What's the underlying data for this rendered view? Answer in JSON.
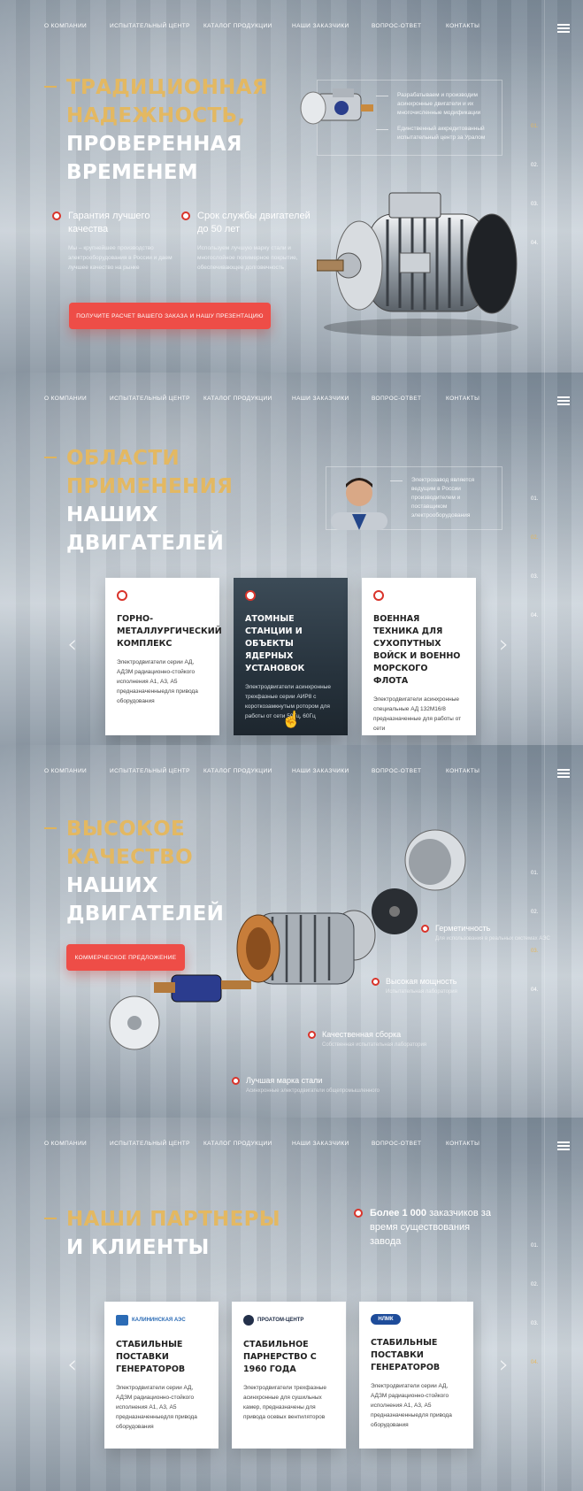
{
  "nav": {
    "items": [
      "О КОМПАНИИ",
      "ИСПЫТАТЕЛЬНЫЙ ЦЕНТР",
      "КАТАЛОГ ПРОДУКЦИИ",
      "НАШИ ЗАКАЗЧИКИ",
      "ВОПРОС-ОТВЕТ",
      "КОНТАКТЫ"
    ]
  },
  "pager": [
    "01.",
    "02.",
    "03.",
    "04."
  ],
  "hero": {
    "title_gold": [
      "ТРАДИЦИОННАЯ",
      "НАДЕЖНОСТЬ,"
    ],
    "title_white": [
      "ПРОВЕРЕННАЯ",
      "ВРЕМЕНЕМ"
    ],
    "info": [
      "Разрабатываем и производим асинхронные двигатели и их многочисленные модификации",
      "Единственный аккредитованный испытательный центр за Уралом"
    ],
    "features": [
      {
        "title": "Гарантия лучшего качества",
        "text": "Мы – крупнейшее производство электрооборудования в России и даем лучшее качество на рынке"
      },
      {
        "title": "Срок службы двигателей до 50 лет",
        "text": "Используем лучшую марку стали и многослойное полимерное покрытие, обеспечивающее долговечность"
      }
    ],
    "cta": "ПОЛУЧИТЕ РАСЧЕТ ВАШЕГО ЗАКАЗА И НАШУ ПРЕЗЕНТАЦИЮ"
  },
  "applications": {
    "title_gold": [
      "ОБЛАСТИ",
      "ПРИМЕНЕНИЯ"
    ],
    "title_white": [
      "НАШИХ",
      "ДВИГАТЕЛЕЙ"
    ],
    "info": "Электрозавод является ведущим в России производителем и поставщиком электрооборудования",
    "cards": [
      {
        "title": "ГОРНО-МЕТАЛЛУРГИЧЕСКИЙ КОМПЛЕКС",
        "text": "Электродвигатели серии АД, АДЗМ радиационно-стойкого исполнения А1, А3, А5 предназначенныедля привода оборудования"
      },
      {
        "title": "АТОМНЫЕ СТАНЦИИ И ОБЪЕКТЫ ЯДЕРНЫХ УСТАНОВОК",
        "text": "Электродвигатели асинхронные трехфазные серии АИР8 с короткозамкнутым ротором для работы от сети 50Гц, 60Гц"
      },
      {
        "title": "ВОЕННАЯ ТЕХНИКА ДЛЯ СУХОПУТНЫХ ВОЙСК И ВОЕННО МОРСКОГО ФЛОТА",
        "text": "Электродвигатели асинхронные специальные АД 132М16/8 предназначенные для работы от сети"
      }
    ]
  },
  "quality": {
    "title_gold": [
      "ВЫСОКОЕ",
      "КАЧЕСТВО"
    ],
    "title_white": [
      "НАШИХ",
      "ДВИГАТЕЛЕЙ"
    ],
    "cta": "КОММЕРЧЕСКОЕ ПРЕДЛОЖЕНИЕ",
    "callouts": [
      {
        "title": "Герметичность",
        "sub": "Для использования в реальных системах АЭС"
      },
      {
        "title": "Высокая мощность",
        "sub": "Испытательная лаборатория"
      },
      {
        "title": "Качественная сборка",
        "sub": "Собственная испытательная лаборатория"
      },
      {
        "title": "Лучшая марка стали",
        "sub": "Асинхронные электродвигатели общепромышленного"
      }
    ]
  },
  "partners": {
    "title_gold": [
      "НАШИ ПАРТНЕРЫ"
    ],
    "title_white": [
      "И КЛИЕНТЫ"
    ],
    "note_bold": "Более 1 000",
    "note_rest": "заказчиков за время существования завода",
    "cards": [
      {
        "logo": "КАЛИНИНСКАЯ АЭС",
        "title": "СТАБИЛЬНЫЕ ПОСТАВКИ ГЕНЕРАТОРОВ",
        "text": "Электродвигатели серии АД, АДЗМ радиационно-стойкого исполнения А1, А3, А5 предназначенныедля привода оборудования"
      },
      {
        "logo": "ПРОАТОМ-ЦЕНТР",
        "title": "СТАБИЛЬНОЕ ПАРНЕРСТВО С 1960 ГОДА",
        "text": "Электродвигатели трехфазные асинхронные для сушильных камер, предназначены для привода осевых вентиляторов"
      },
      {
        "logo": "НЛМК",
        "title": "СТАБИЛЬНЫЕ ПОСТАВКИ ГЕНЕРАТОРОВ",
        "text": "Электродвигатели серии АД, АДЗМ радиационно-стойкого исполнения А1, А3, А5 предназначенныедля привода оборудования"
      }
    ]
  },
  "colors": {
    "gold": "#e3b862",
    "red": "#ee4d47",
    "bg": "#a7b2bc"
  }
}
